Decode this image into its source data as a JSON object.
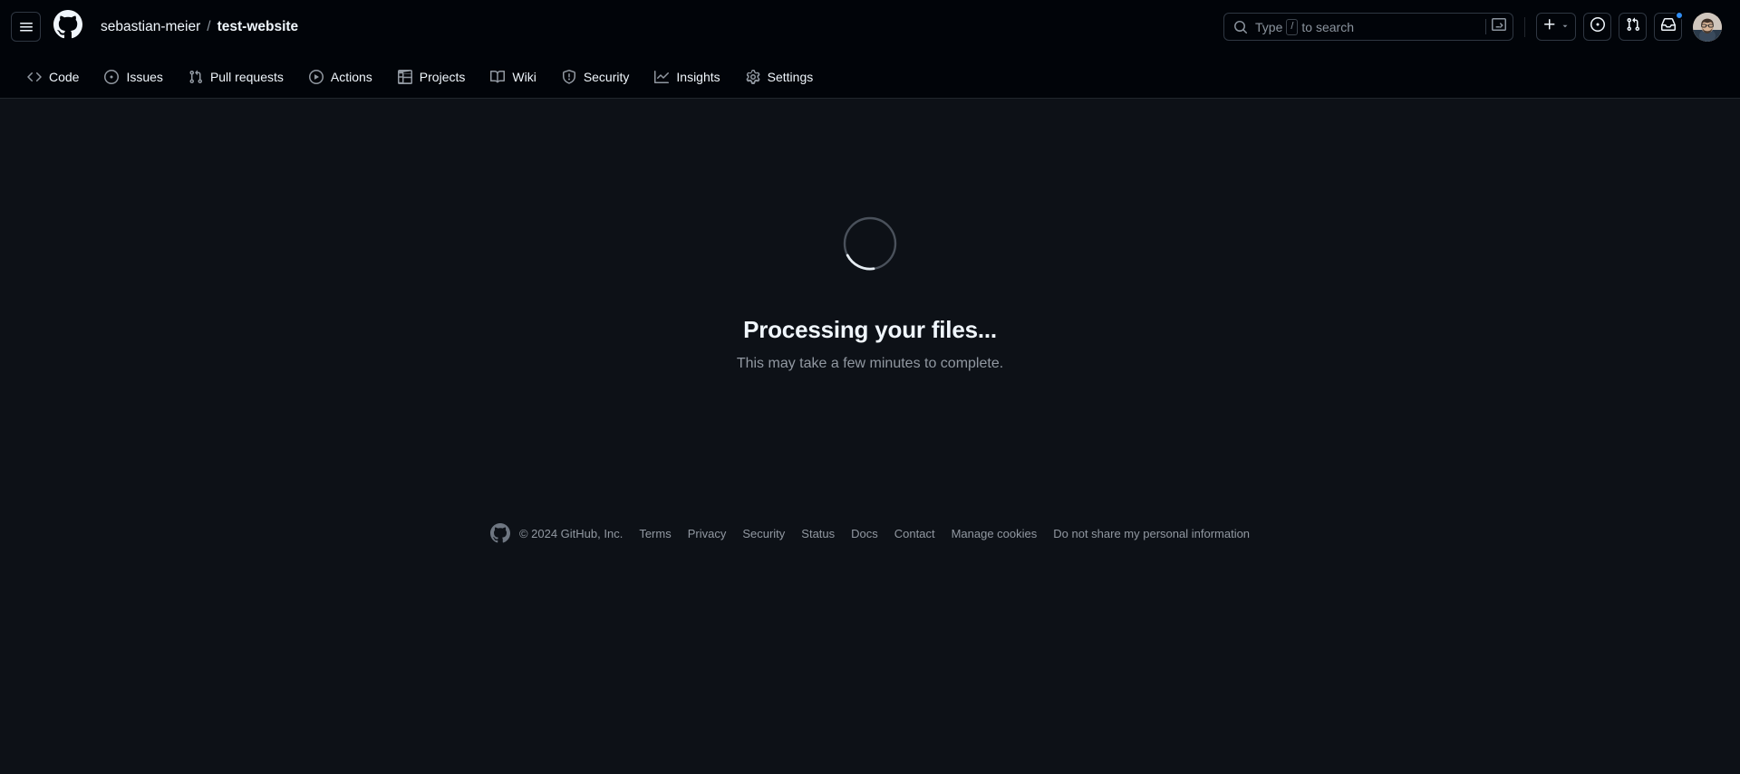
{
  "header": {
    "menu_label": "Open global navigation menu",
    "logo_label": "Homepage",
    "owner": "sebastian-meier",
    "separator": "/",
    "repo": "test-website",
    "search": {
      "placeholder_prefix": "Type",
      "key_hint": "/",
      "placeholder_suffix": "to search"
    },
    "create_new_label": "Create new...",
    "issues_label": "Your issues",
    "pull_requests_label": "Your pull requests",
    "notifications_label": "Notifications",
    "avatar_label": "Open user account menu",
    "has_unread_notifications": true,
    "notification_dot_color": "#318ef4"
  },
  "repo_nav": {
    "items": [
      {
        "label": "Code",
        "icon": "code-icon"
      },
      {
        "label": "Issues",
        "icon": "issue-opened-icon"
      },
      {
        "label": "Pull requests",
        "icon": "git-pull-request-icon"
      },
      {
        "label": "Actions",
        "icon": "play-icon"
      },
      {
        "label": "Projects",
        "icon": "table-icon"
      },
      {
        "label": "Wiki",
        "icon": "book-icon"
      },
      {
        "label": "Security",
        "icon": "shield-icon"
      },
      {
        "label": "Insights",
        "icon": "graph-icon"
      },
      {
        "label": "Settings",
        "icon": "gear-icon"
      }
    ]
  },
  "main": {
    "spinner_label": "Loading",
    "title": "Processing your files...",
    "subtitle": "This may take a few minutes to complete."
  },
  "footer": {
    "copyright": "© 2024 GitHub, Inc.",
    "links": [
      "Terms",
      "Privacy",
      "Security",
      "Status",
      "Docs",
      "Contact",
      "Manage cookies",
      "Do not share my personal information"
    ]
  },
  "colors": {
    "header_bg": "#010409",
    "body_bg": "#0d1117",
    "border": "#21262d",
    "text": "#f0f6fc",
    "muted": "#9198a1",
    "accent": "#318ef4"
  }
}
